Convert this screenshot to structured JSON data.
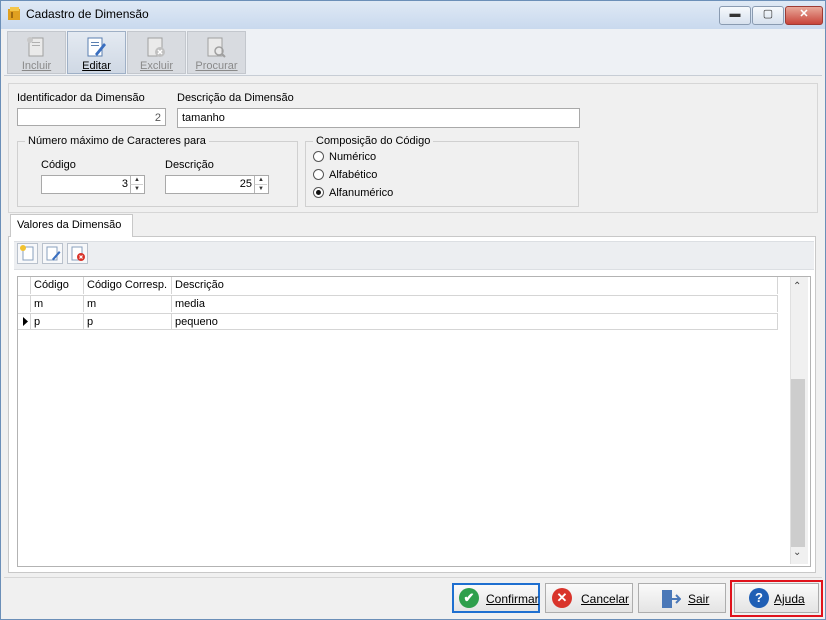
{
  "window": {
    "title": "Cadastro de Dimensão",
    "minimize": "▬",
    "maximize": "▢",
    "close": "✕"
  },
  "toolbar": {
    "incluir": "Incluir",
    "editar": "Editar",
    "excluir": "Excluir",
    "procurar": "Procurar"
  },
  "form": {
    "id_label": "Identificador da Dimensão",
    "id_value": "2",
    "desc_label": "Descrição da Dimensão",
    "desc_value": "tamanho",
    "maxchars_title": "Número máximo de Caracteres para",
    "codigo_label": "Código",
    "codigo_value": "3",
    "descricao_label": "Descrição",
    "descricao_value": "25",
    "composicao_title": "Composição do Código",
    "options": [
      "Numérico",
      "Alfabético",
      "Alfanumérico"
    ],
    "selected_option": "Alfanumérico"
  },
  "tab": {
    "label": "Valores da Dimensão"
  },
  "grid": {
    "columns": [
      "Código",
      "Código Corresp.",
      "Descrição"
    ],
    "rows": [
      [
        "m",
        "m",
        "media"
      ],
      [
        "p",
        "p",
        "pequeno"
      ]
    ],
    "current_row": 1
  },
  "buttons": {
    "confirmar": "Confirmar",
    "cancelar": "Cancelar",
    "sair": "Sair",
    "ajuda": "Ajuda"
  },
  "colors": {
    "accent": "#1e6fd0",
    "ajuda_highlight": "#e0121b",
    "confirm_icon": "#2e9f4c",
    "cancel_icon": "#d9342b",
    "help_icon": "#1f5fb5"
  }
}
